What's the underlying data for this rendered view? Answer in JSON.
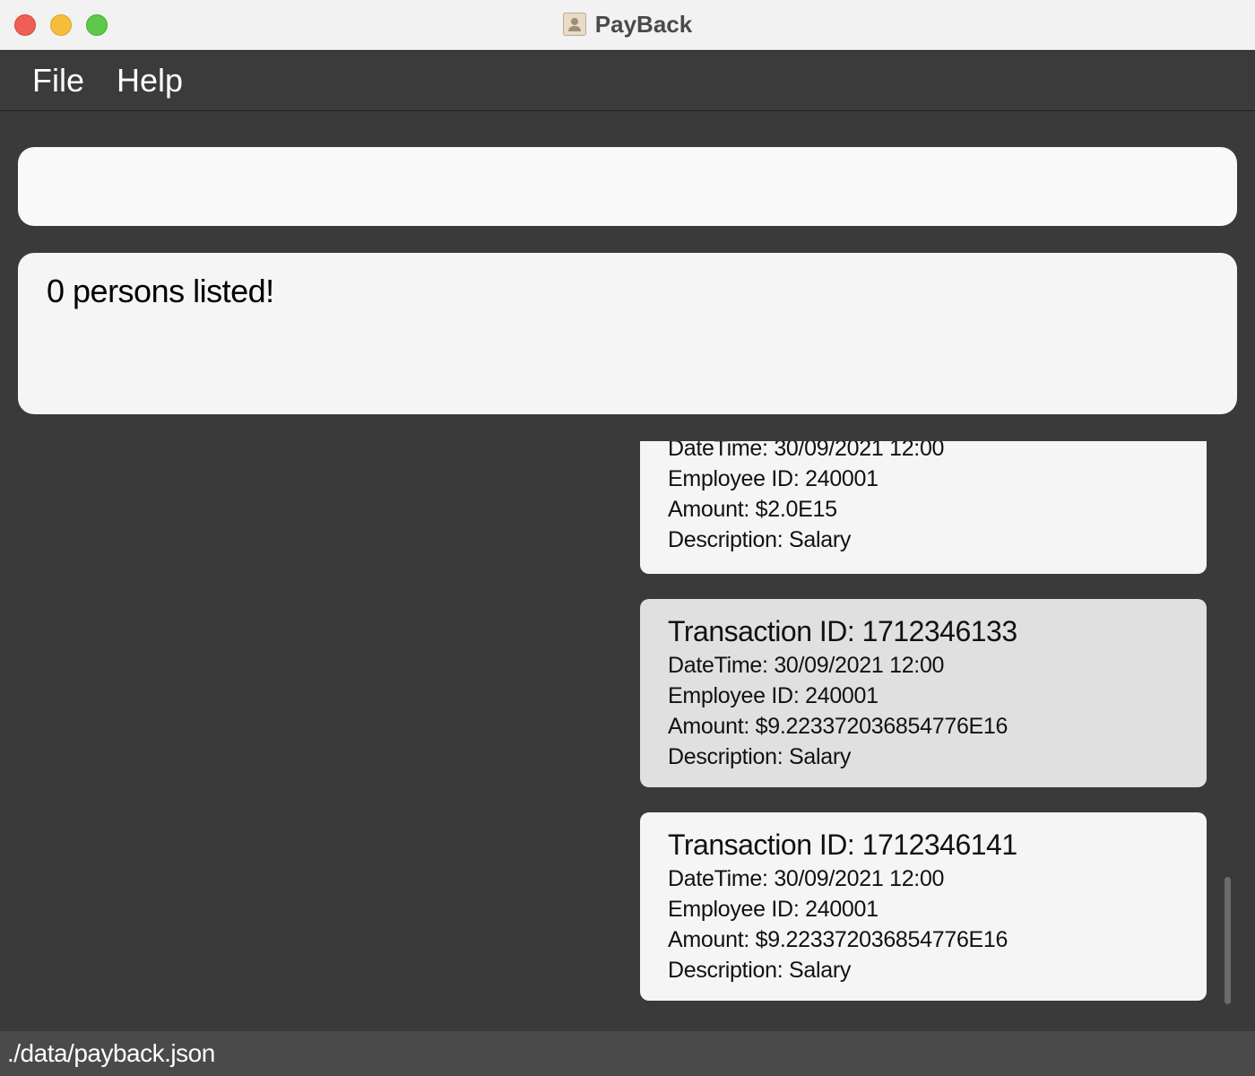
{
  "window": {
    "title": "PayBack"
  },
  "menu": {
    "file": "File",
    "help": "Help"
  },
  "command": {
    "value": "",
    "placeholder": ""
  },
  "result": {
    "message": "0 persons listed!"
  },
  "transactions": [
    {
      "transaction_id": "",
      "datetime": "DateTime: 30/09/2021 12:00",
      "employee_id": "Employee ID: 240001",
      "amount": "Amount: $2.0E15",
      "description": "Description: Salary"
    },
    {
      "transaction_id": "Transaction ID: 1712346133",
      "datetime": "DateTime: 30/09/2021 12:00",
      "employee_id": "Employee ID: 240001",
      "amount": "Amount: $9.223372036854776E16",
      "description": "Description: Salary"
    },
    {
      "transaction_id": "Transaction ID: 1712346141",
      "datetime": "DateTime: 30/09/2021 12:00",
      "employee_id": "Employee ID: 240001",
      "amount": "Amount: $9.223372036854776E16",
      "description": "Description: Salary"
    }
  ],
  "status": {
    "file_path": "./data/payback.json"
  }
}
